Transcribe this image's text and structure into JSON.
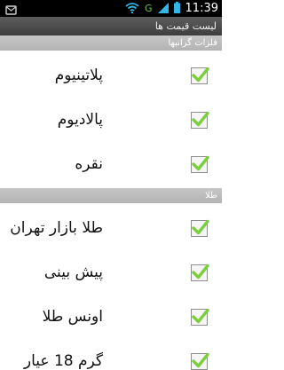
{
  "status_bar": {
    "network": "G",
    "time": "11:39",
    "icons": [
      "notification-icon",
      "wifi-icon",
      "signal-icon",
      "battery-icon"
    ]
  },
  "app_bar": {
    "title": "لیست قیمت ها"
  },
  "sections": [
    {
      "header": "فلزات گرانبها",
      "items": [
        {
          "label": "پلاتینیوم",
          "checked": true
        },
        {
          "label": "پالادیوم",
          "checked": true
        },
        {
          "label": "نقره",
          "checked": true
        }
      ]
    },
    {
      "header": "طلا",
      "items": [
        {
          "label": "طلا بازار تهران",
          "checked": true
        },
        {
          "label": "پیش بینی",
          "checked": true
        },
        {
          "label": "اونس طلا",
          "checked": true
        },
        {
          "label": "گرم 18 عیار",
          "checked": true
        }
      ]
    }
  ],
  "colors": {
    "checkmark": "#7ccf3c",
    "section_header": "#bdbdbd",
    "action_bar": "#4a4a4a"
  }
}
